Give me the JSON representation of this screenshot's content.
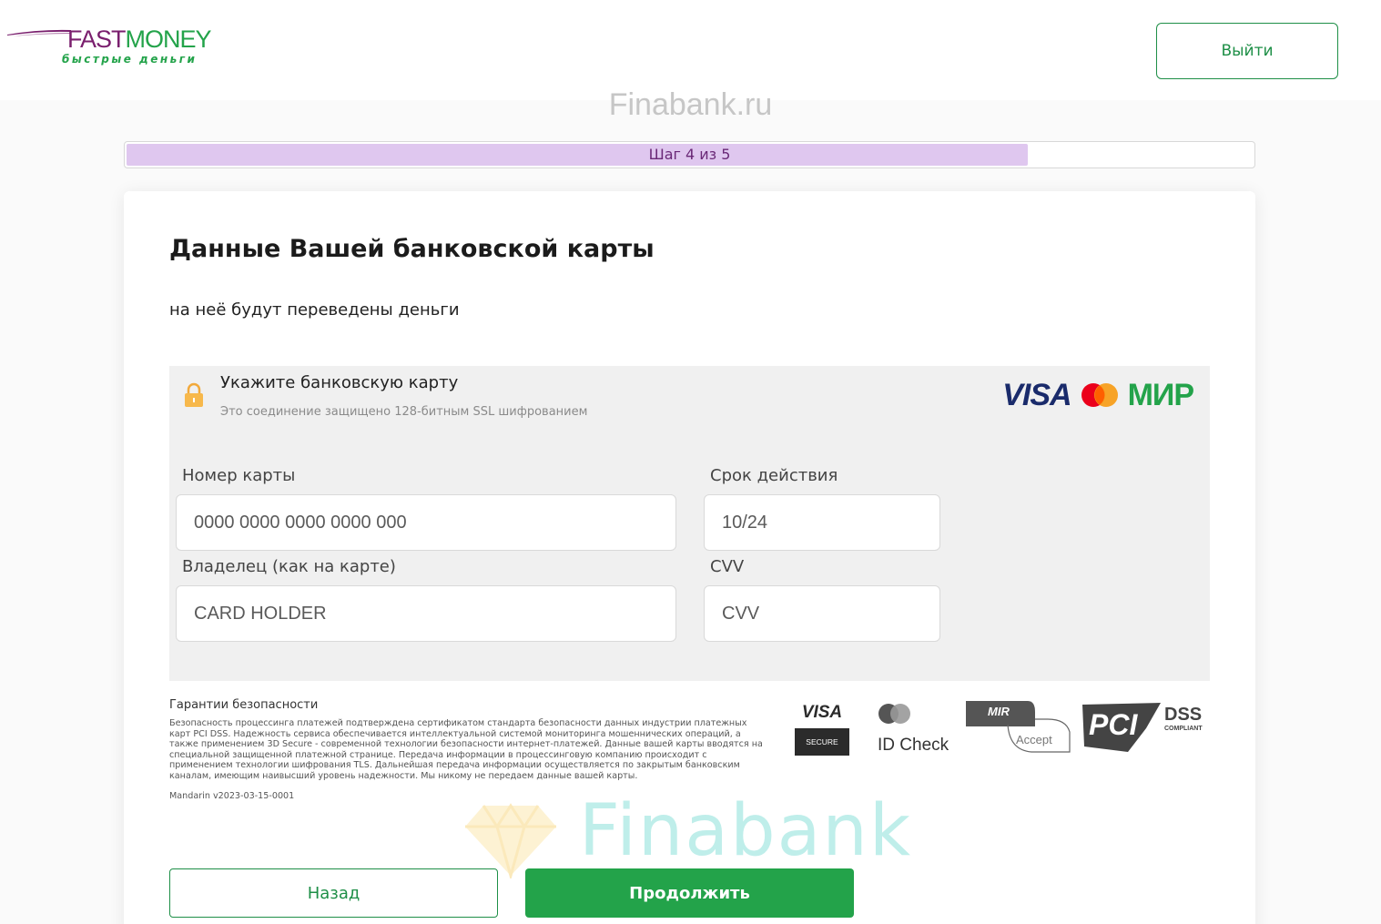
{
  "header": {
    "logo_primary": "FAST",
    "logo_secondary": "MONEY",
    "logo_tagline": "быстрые деньги",
    "logout_label": "Выйти"
  },
  "watermark": {
    "top_text": "Finabank.ru",
    "bottom_text": "Finabank"
  },
  "progress": {
    "label": "Шаг 4 из 5",
    "current_step": 4,
    "total_steps": 5,
    "fraction": 0.8
  },
  "form": {
    "title": "Данные Вашей банковской карты",
    "subtitle": "на неё будут переведены деньги",
    "payment_box": {
      "heading": "Укажите банковскую карту",
      "ssl_note": "Это соединение защищено 128-битным SSL шифрованием",
      "brands": [
        "VISA",
        "Mastercard",
        "МИР"
      ],
      "brand_visa_text": "VISA",
      "brand_mir_text": "МИР"
    },
    "fields": {
      "card_number": {
        "label": "Номер карты",
        "placeholder": "0000 0000 0000 0000 000"
      },
      "expiry": {
        "label": "Срок действия",
        "placeholder": "10/24"
      },
      "holder": {
        "label": "Владелец (как на карте)",
        "placeholder": "CARD HOLDER"
      },
      "cvv": {
        "label": "CVV",
        "placeholder": "CVV"
      }
    },
    "security": {
      "title": "Гарантии безопасности",
      "text": "Безопасность процессинга платежей подтверждена сертификатом стандарта безопасности данных индустрии платежных карт PCI DSS. Надежность сервиса обеспечивается интеллектуальной системой мониторинга мошеннических операций, а также применением 3D Secure - современной технологии безопасности интернет-платежей. Данные вашей карты вводятся на специальной защищенной платежной странице. Передача информации в процессинговую компанию происходит с применением технологии шифрования TLS. Дальнейшая передача информации осуществляется по закрытым банковским каналам, имеющим наивысший уровень надежности. Мы никому не передаем данные вашей карты.",
      "version": "Mandarin v2023-03-15-0001",
      "logos": {
        "visa_top": "VISA",
        "visa_bottom": "SECURE",
        "id_check": "ID Check",
        "mir_text": "MIR",
        "accept_text": "Accept",
        "pci_text": "PCI",
        "dss_text": "DSS",
        "compliant_text": "COMPLIANT"
      }
    },
    "buttons": {
      "back_label": "Назад",
      "next_label": "Продолжить"
    }
  },
  "colors": {
    "brand_green": "#23a34a",
    "brand_purple": "#7a1f6e",
    "progress_fill": "#dfc7ef",
    "payment_box_bg": "#f0f0f0"
  }
}
